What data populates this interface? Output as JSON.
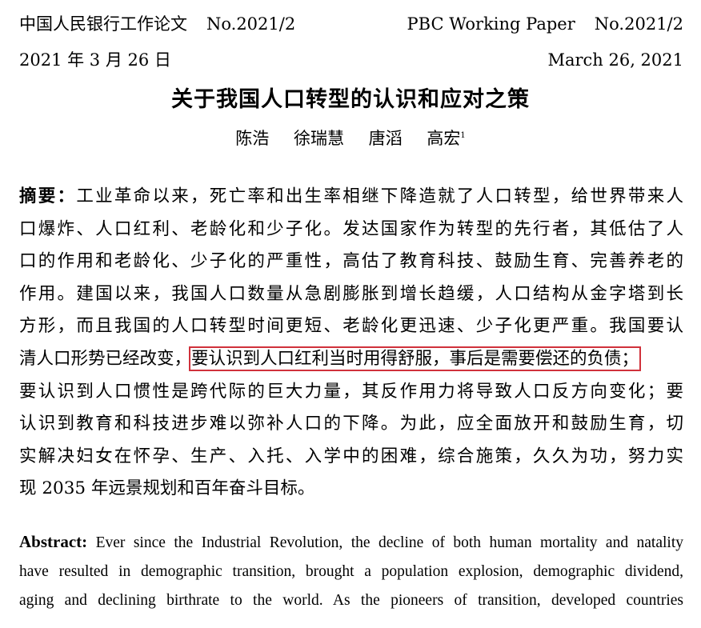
{
  "header": {
    "left_series_cn": "中国人民银行工作论文",
    "left_number": "No.2021/2",
    "right_series_en": "PBC Working Paper",
    "right_number": "No.2021/2",
    "date_cn": "2021 年 3 月 26 日",
    "date_en": "March 26, 2021"
  },
  "title": "关于我国人口转型的认识和应对之策",
  "authors": [
    "陈浩",
    "徐瑞慧",
    "唐滔",
    "高宏"
  ],
  "author_footnote": "1",
  "abstract_cn": {
    "label": "摘要：",
    "lines": [
      "工业革命以来，死亡率和出生率相继下降造就了人口转型，给世界带来人",
      "口爆炸、人口红利、老龄化和少子化。发达国家作为转型的先行者，其低估了人",
      "口的作用和老龄化、少子化的严重性，高估了教育科技、鼓励生育、完善养老的",
      "作用。建国以来，我国人口数量从急剧膨胀到增长趋缓，人口结构从金字塔到长",
      "方形，而且我国的人口转型时间更短、老龄化更迅速、少子化更严重。我国要认"
    ],
    "line6_before": "清人口形势已经改变，",
    "line6_highlight": "要认识到人口红利当时用得舒服，事后是需要偿还的负债；",
    "lines_after": [
      "要认识到人口惯性是跨代际的巨大力量，其反作用力将导致人口反方向变化；要",
      "认识到教育和科技进步难以弥补人口的下降。为此，应全面放开和鼓励生育，切",
      "实解决妇女在怀孕、生产、入托、入学中的困难，综合施策，久久为功，努力实"
    ],
    "last_line": "现 2035 年远景规划和百年奋斗目标。",
    "highlight_color": "#d0313b"
  },
  "abstract_en": {
    "label": "Abstract:",
    "line1": "Ever since the Industrial Revolution, the decline of both human mortality and natality",
    "line2": "have resulted in demographic transition, brought a population explosion, demographic dividend,",
    "line3": "aging and declining birthrate to the world. As the pioneers of transition, developed countries"
  }
}
